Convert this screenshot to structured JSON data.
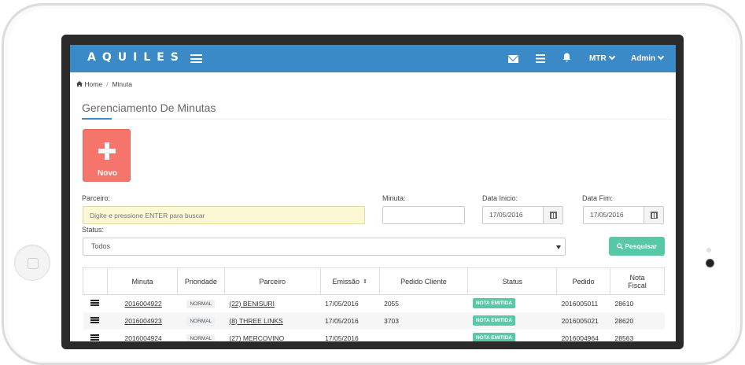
{
  "app": {
    "logo": "AQUILES",
    "topbar": {
      "user_menu": "MTR",
      "admin_menu": "Admin"
    },
    "icons": {
      "mail": "envelope-icon",
      "list": "list-icon",
      "bell": "bell-icon"
    },
    "accent_color": "#3a8ac7"
  },
  "breadcrumb": {
    "home": "Home",
    "current": "Minuta"
  },
  "page": {
    "title": "Gerenciamento De Minutas",
    "new_button": "Novo"
  },
  "filters": {
    "parceiro_label": "Parceiro:",
    "parceiro_placeholder": "Digite e pressione ENTER para buscar",
    "minuta_label": "Minuta:",
    "minuta_value": "",
    "data_inicio_label": "Data Inicio:",
    "data_inicio_value": "17/05/2016",
    "data_fim_label": "Data Fim:",
    "data_fim_value": "17/05/2016",
    "status_label": "Status:",
    "status_value": "Todos",
    "search_button": "Pesquisar"
  },
  "table": {
    "headers": {
      "minuta": "Minuta",
      "prioridade": "Prioridade",
      "parceiro": "Parceiro",
      "emissao": "Emissão",
      "pedido_cliente": "Pedido Cliente",
      "status": "Status",
      "pedido": "Pedido",
      "nota_fiscal_1": "Nota",
      "nota_fiscal_2": "Fiscal"
    },
    "rows": [
      {
        "minuta": "2016004922",
        "prioridade": "NORMAL",
        "parceiro": "(22) BENISURI",
        "emissao": "17/05/2016",
        "pedido_cliente": "2055",
        "status": "NOTA EMITIDA",
        "pedido": "2016005011",
        "nota_fiscal": "28610"
      },
      {
        "minuta": "2016004923",
        "prioridade": "NORMAL",
        "parceiro": "(8) THREE LINKS",
        "emissao": "17/05/2016",
        "pedido_cliente": "3703",
        "status": "NOTA EMITIDA",
        "pedido": "2016005021",
        "nota_fiscal": "28620"
      },
      {
        "minuta": "2016004924",
        "prioridade": "NORMAL",
        "parceiro": "(27) MERCOVINO",
        "emissao": "17/05/2016",
        "pedido_cliente": "",
        "status": "NOTA EMITIDA",
        "pedido": "2016004964",
        "nota_fiscal": "28563"
      }
    ]
  }
}
